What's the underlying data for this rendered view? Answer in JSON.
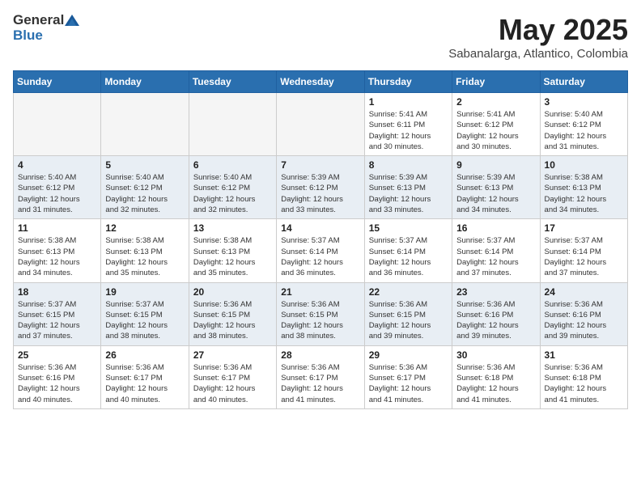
{
  "header": {
    "logo_general": "General",
    "logo_blue": "Blue",
    "month": "May 2025",
    "location": "Sabanalarga, Atlantico, Colombia"
  },
  "weekdays": [
    "Sunday",
    "Monday",
    "Tuesday",
    "Wednesday",
    "Thursday",
    "Friday",
    "Saturday"
  ],
  "weeks": [
    [
      {
        "day": "",
        "info": ""
      },
      {
        "day": "",
        "info": ""
      },
      {
        "day": "",
        "info": ""
      },
      {
        "day": "",
        "info": ""
      },
      {
        "day": "1",
        "info": "Sunrise: 5:41 AM\nSunset: 6:11 PM\nDaylight: 12 hours\nand 30 minutes."
      },
      {
        "day": "2",
        "info": "Sunrise: 5:41 AM\nSunset: 6:12 PM\nDaylight: 12 hours\nand 30 minutes."
      },
      {
        "day": "3",
        "info": "Sunrise: 5:40 AM\nSunset: 6:12 PM\nDaylight: 12 hours\nand 31 minutes."
      }
    ],
    [
      {
        "day": "4",
        "info": "Sunrise: 5:40 AM\nSunset: 6:12 PM\nDaylight: 12 hours\nand 31 minutes."
      },
      {
        "day": "5",
        "info": "Sunrise: 5:40 AM\nSunset: 6:12 PM\nDaylight: 12 hours\nand 32 minutes."
      },
      {
        "day": "6",
        "info": "Sunrise: 5:40 AM\nSunset: 6:12 PM\nDaylight: 12 hours\nand 32 minutes."
      },
      {
        "day": "7",
        "info": "Sunrise: 5:39 AM\nSunset: 6:12 PM\nDaylight: 12 hours\nand 33 minutes."
      },
      {
        "day": "8",
        "info": "Sunrise: 5:39 AM\nSunset: 6:13 PM\nDaylight: 12 hours\nand 33 minutes."
      },
      {
        "day": "9",
        "info": "Sunrise: 5:39 AM\nSunset: 6:13 PM\nDaylight: 12 hours\nand 34 minutes."
      },
      {
        "day": "10",
        "info": "Sunrise: 5:38 AM\nSunset: 6:13 PM\nDaylight: 12 hours\nand 34 minutes."
      }
    ],
    [
      {
        "day": "11",
        "info": "Sunrise: 5:38 AM\nSunset: 6:13 PM\nDaylight: 12 hours\nand 34 minutes."
      },
      {
        "day": "12",
        "info": "Sunrise: 5:38 AM\nSunset: 6:13 PM\nDaylight: 12 hours\nand 35 minutes."
      },
      {
        "day": "13",
        "info": "Sunrise: 5:38 AM\nSunset: 6:13 PM\nDaylight: 12 hours\nand 35 minutes."
      },
      {
        "day": "14",
        "info": "Sunrise: 5:37 AM\nSunset: 6:14 PM\nDaylight: 12 hours\nand 36 minutes."
      },
      {
        "day": "15",
        "info": "Sunrise: 5:37 AM\nSunset: 6:14 PM\nDaylight: 12 hours\nand 36 minutes."
      },
      {
        "day": "16",
        "info": "Sunrise: 5:37 AM\nSunset: 6:14 PM\nDaylight: 12 hours\nand 37 minutes."
      },
      {
        "day": "17",
        "info": "Sunrise: 5:37 AM\nSunset: 6:14 PM\nDaylight: 12 hours\nand 37 minutes."
      }
    ],
    [
      {
        "day": "18",
        "info": "Sunrise: 5:37 AM\nSunset: 6:15 PM\nDaylight: 12 hours\nand 37 minutes."
      },
      {
        "day": "19",
        "info": "Sunrise: 5:37 AM\nSunset: 6:15 PM\nDaylight: 12 hours\nand 38 minutes."
      },
      {
        "day": "20",
        "info": "Sunrise: 5:36 AM\nSunset: 6:15 PM\nDaylight: 12 hours\nand 38 minutes."
      },
      {
        "day": "21",
        "info": "Sunrise: 5:36 AM\nSunset: 6:15 PM\nDaylight: 12 hours\nand 38 minutes."
      },
      {
        "day": "22",
        "info": "Sunrise: 5:36 AM\nSunset: 6:15 PM\nDaylight: 12 hours\nand 39 minutes."
      },
      {
        "day": "23",
        "info": "Sunrise: 5:36 AM\nSunset: 6:16 PM\nDaylight: 12 hours\nand 39 minutes."
      },
      {
        "day": "24",
        "info": "Sunrise: 5:36 AM\nSunset: 6:16 PM\nDaylight: 12 hours\nand 39 minutes."
      }
    ],
    [
      {
        "day": "25",
        "info": "Sunrise: 5:36 AM\nSunset: 6:16 PM\nDaylight: 12 hours\nand 40 minutes."
      },
      {
        "day": "26",
        "info": "Sunrise: 5:36 AM\nSunset: 6:17 PM\nDaylight: 12 hours\nand 40 minutes."
      },
      {
        "day": "27",
        "info": "Sunrise: 5:36 AM\nSunset: 6:17 PM\nDaylight: 12 hours\nand 40 minutes."
      },
      {
        "day": "28",
        "info": "Sunrise: 5:36 AM\nSunset: 6:17 PM\nDaylight: 12 hours\nand 41 minutes."
      },
      {
        "day": "29",
        "info": "Sunrise: 5:36 AM\nSunset: 6:17 PM\nDaylight: 12 hours\nand 41 minutes."
      },
      {
        "day": "30",
        "info": "Sunrise: 5:36 AM\nSunset: 6:18 PM\nDaylight: 12 hours\nand 41 minutes."
      },
      {
        "day": "31",
        "info": "Sunrise: 5:36 AM\nSunset: 6:18 PM\nDaylight: 12 hours\nand 41 minutes."
      }
    ]
  ]
}
